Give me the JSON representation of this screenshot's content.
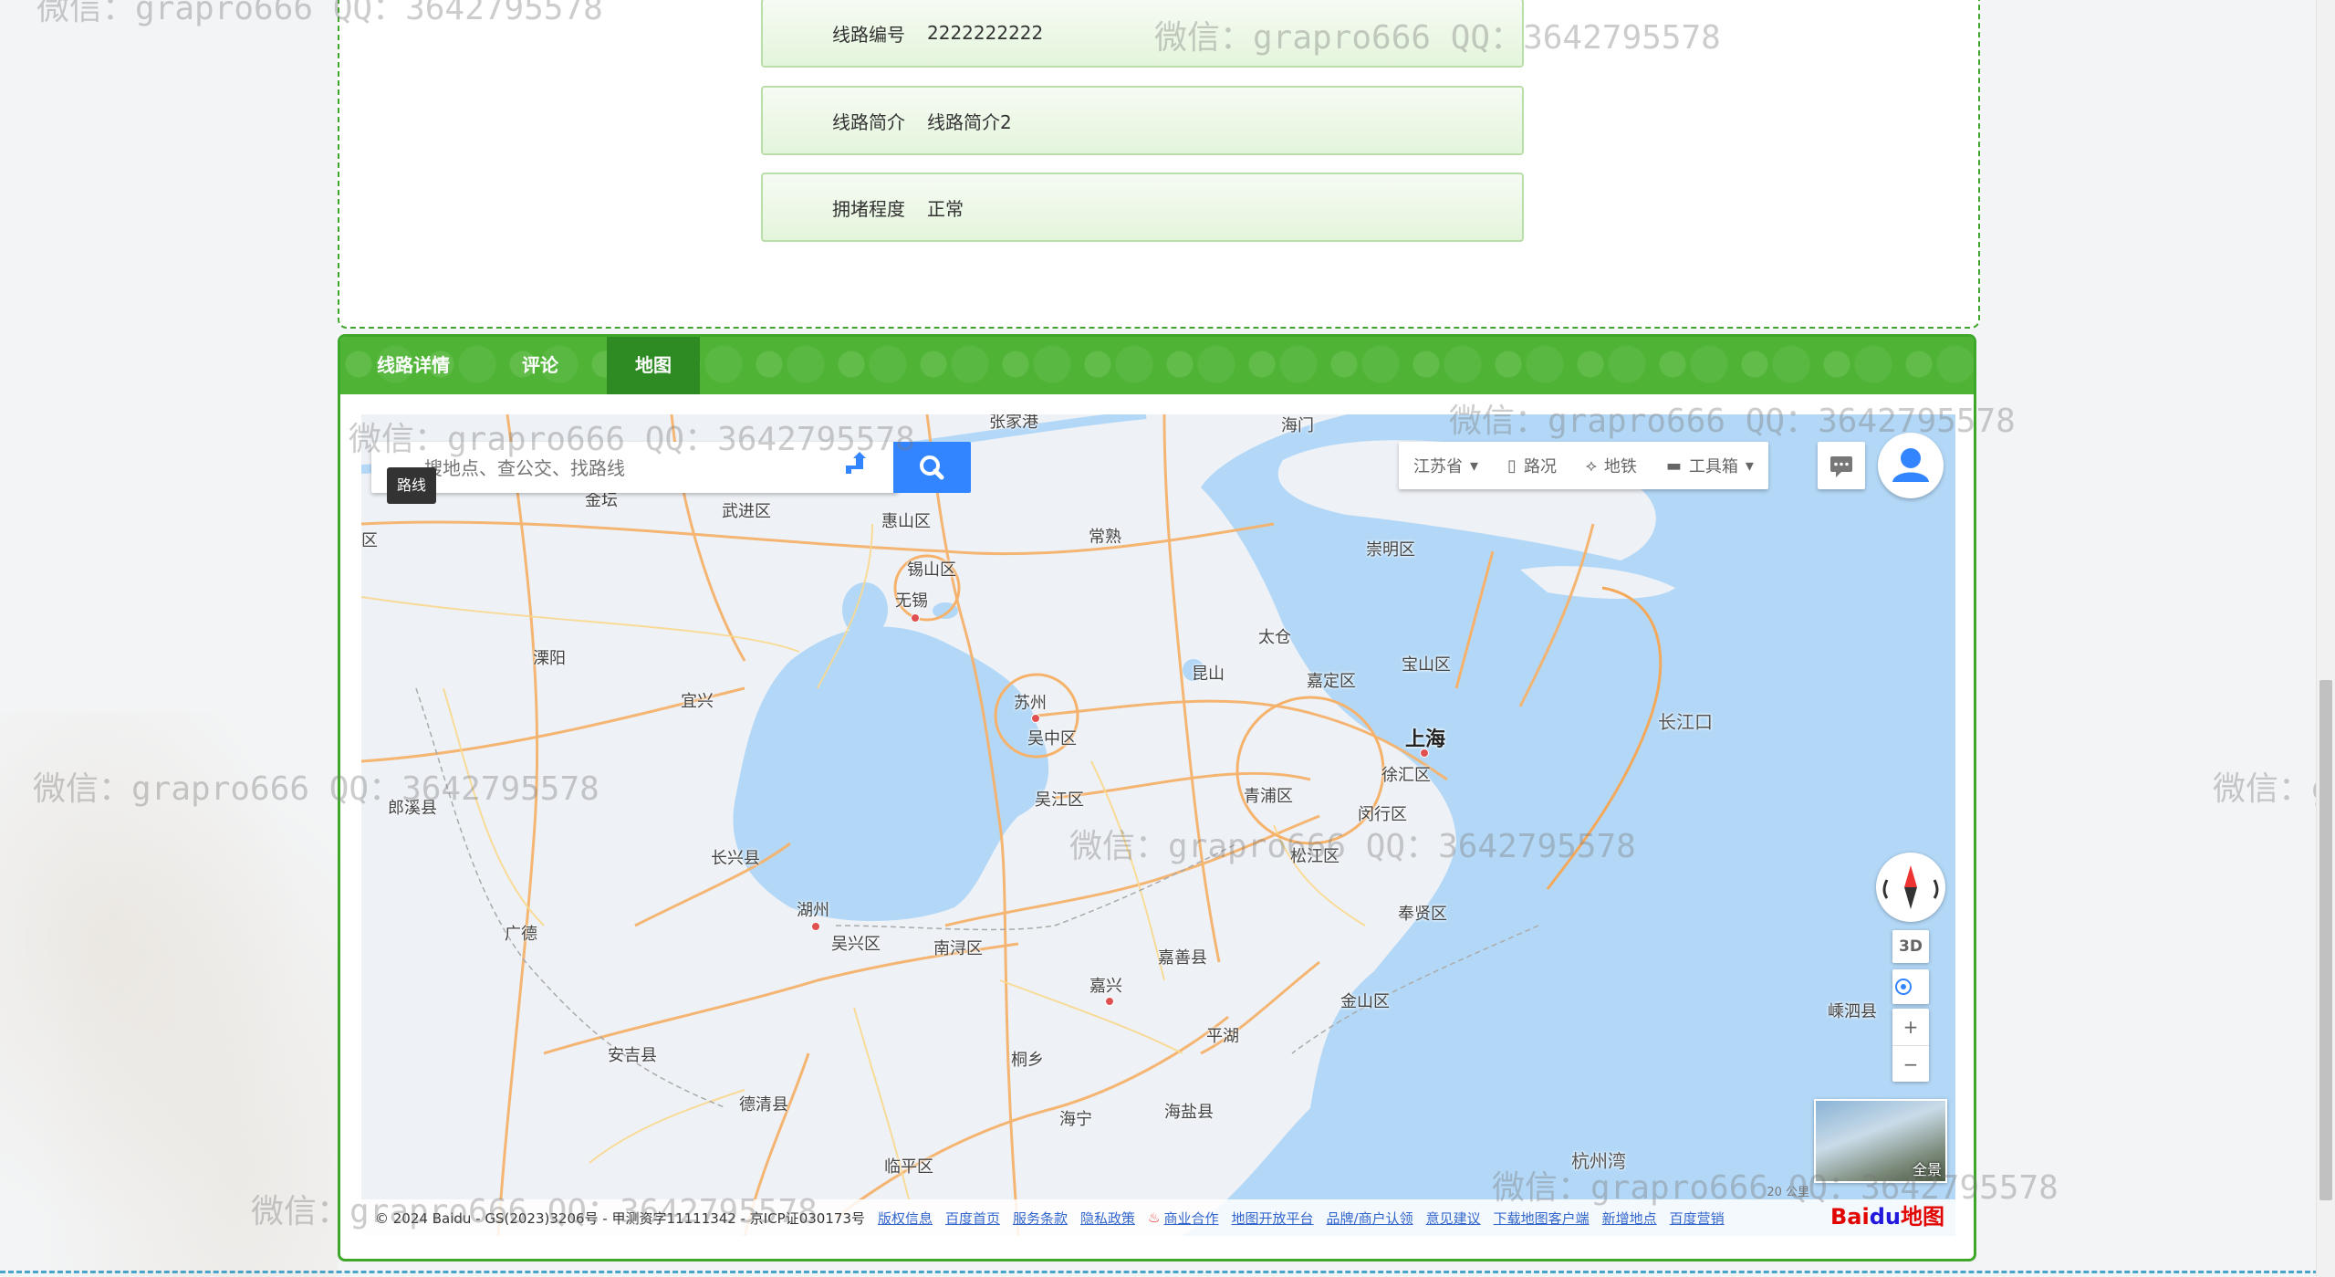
{
  "info": {
    "rows": [
      {
        "label": "线路编号",
        "value": "2222222222"
      },
      {
        "label": "线路简介",
        "value": "线路简介2"
      },
      {
        "label": "拥堵程度",
        "value": "正常"
      }
    ]
  },
  "tabs": [
    {
      "label": "线路详情"
    },
    {
      "label": "评论"
    },
    {
      "label": "地图"
    }
  ],
  "map": {
    "search_placeholder": "搜地点、查公交、找路线",
    "tooltip": "路线",
    "province": "江苏省",
    "tool_traffic": "路况",
    "tool_subway": "地铁",
    "tool_box": "工具箱",
    "btn_3d": "3D",
    "zoom_in": "+",
    "zoom_out": "−",
    "pano_label": "全景",
    "scale": "20 公里",
    "copyright": "© 2024 Baidu - GS(2023)3206号 - 甲测资字11111342 - 京ICP证030173号",
    "footer_links": [
      "版权信息",
      "百度首页",
      "服务条款",
      "隐私政策",
      "商业合作",
      "地图开放平台",
      "品牌/商户认领",
      "意见建议",
      "下载地图客户端",
      "新增地点",
      "百度营销"
    ],
    "logo_text_1": "Bai",
    "logo_text_2": "du",
    "logo_text_3": "地图",
    "labels": {
      "zhangjiagang": "张家港",
      "haimen": "海门",
      "jintan": "金坛",
      "wujin": "武进区",
      "huishan": "惠山区",
      "changshu": "常熟",
      "chongming": "崇明区",
      "xishan": "锡山区",
      "wuxi": "无锡",
      "taicang": "太仓",
      "baoshan": "宝山区",
      "liyang": "溧阳",
      "yixing": "宜兴",
      "kunshan": "昆山",
      "jiading": "嘉定区",
      "suzhou": "苏州",
      "wuzhong": "吴中区",
      "shanghai": "上海",
      "changjiangkou": "长江口",
      "xuhui": "徐汇区",
      "langxi": "郎溪县",
      "wujiang": "吴江区",
      "qingpu": "青浦区",
      "minhang": "闵行区",
      "changxing": "长兴县",
      "songjiang": "松江区",
      "huzhou": "湖州",
      "guangde": "广德",
      "wuxing": "吴兴区",
      "nanxun": "南浔区",
      "fengxian": "奉贤区",
      "jiashan": "嘉善县",
      "jiaxing": "嘉兴",
      "jinshan": "金山区",
      "shengsi": "嵊泗县",
      "pinghu": "平湖",
      "anji": "安吉县",
      "tongxiang": "桐乡",
      "deqing": "德清县",
      "haiyan": "海盐县",
      "haining": "海宁",
      "linping": "临平区",
      "hangzhouwan": "杭州湾",
      "edge": "区"
    }
  },
  "watermark": "微信：grapro666 QQ：3642795578"
}
